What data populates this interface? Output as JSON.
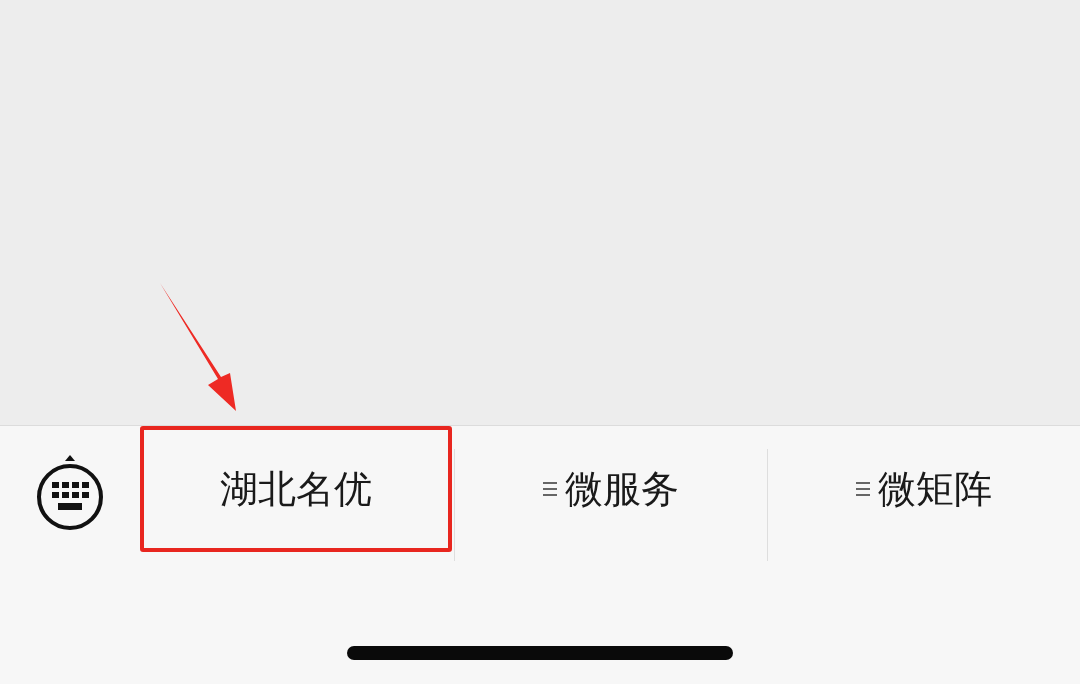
{
  "menu_bar": {
    "items": [
      {
        "label": "湖北名优",
        "has_submenu": false,
        "highlighted": true
      },
      {
        "label": "微服务",
        "has_submenu": true,
        "highlighted": false
      },
      {
        "label": "微矩阵",
        "has_submenu": true,
        "highlighted": false
      }
    ]
  },
  "annotation": {
    "kind": "arrow"
  }
}
